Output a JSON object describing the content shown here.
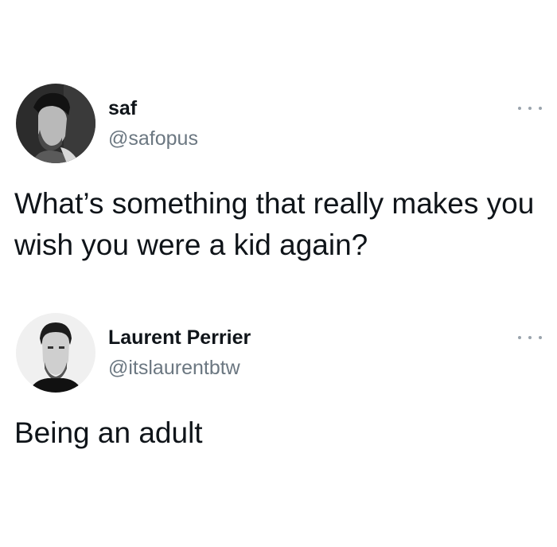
{
  "tweets": [
    {
      "name": "saf",
      "handle": "@safopus",
      "text": "What’s something that really makes you wish you were a kid again?",
      "avatar_icon": "avatar-photo"
    },
    {
      "name": "Laurent Perrier",
      "handle": "@itslaurentbtw",
      "text": "Being an adult",
      "avatar_icon": "avatar-photo"
    }
  ],
  "menu_icon": "more-options-icon",
  "colors": {
    "text": "#0f1419",
    "handle": "#6b7781",
    "dots": "#9aa4ad",
    "background": "#ffffff"
  }
}
